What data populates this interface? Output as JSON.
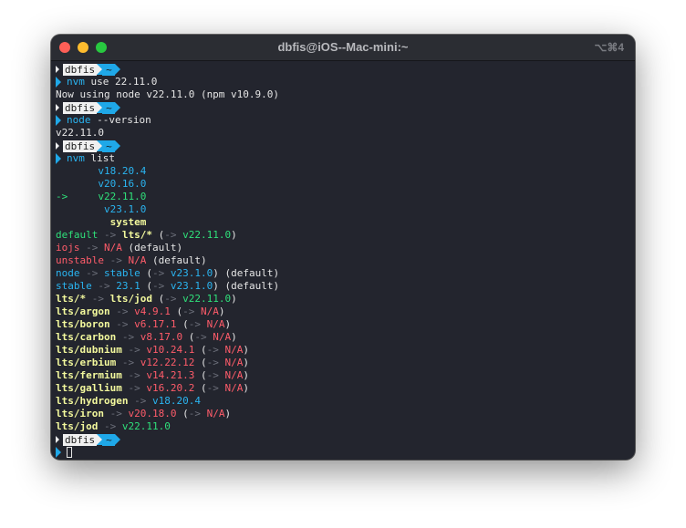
{
  "window": {
    "title": "dbfis@iOS--Mac-mini:~",
    "shortcut": "⌥⌘4"
  },
  "prompt": {
    "user": "dbfis",
    "dir": "~"
  },
  "lines": [
    {
      "kind": "prompt"
    },
    {
      "kind": "cmd",
      "segs": [
        {
          "t": "nvm",
          "c": "blue"
        },
        {
          "t": " use 22.11.0",
          "c": "white"
        }
      ]
    },
    {
      "kind": "out",
      "segs": [
        {
          "t": "Now using node v22.11.0 (npm v10.9.0)",
          "c": "white"
        }
      ]
    },
    {
      "kind": "prompt"
    },
    {
      "kind": "cmd",
      "segs": [
        {
          "t": "node",
          "c": "blue"
        },
        {
          "t": " --version",
          "c": "white"
        }
      ]
    },
    {
      "kind": "out",
      "segs": [
        {
          "t": "v22.11.0",
          "c": "white"
        }
      ]
    },
    {
      "kind": "prompt"
    },
    {
      "kind": "cmd",
      "segs": [
        {
          "t": "nvm",
          "c": "blue"
        },
        {
          "t": " list",
          "c": "white"
        }
      ]
    },
    {
      "kind": "out",
      "segs": [
        {
          "t": "       v18.20.4",
          "c": "blue"
        }
      ]
    },
    {
      "kind": "out",
      "segs": [
        {
          "t": "       v20.16.0",
          "c": "blue"
        }
      ]
    },
    {
      "kind": "out",
      "segs": [
        {
          "t": "->     v22.11.0",
          "c": "green"
        }
      ]
    },
    {
      "kind": "out",
      "segs": [
        {
          "t": "        v23.1.0",
          "c": "blue"
        }
      ]
    },
    {
      "kind": "out",
      "segs": [
        {
          "t": "         system",
          "c": "yellow"
        }
      ]
    },
    {
      "kind": "out",
      "segs": [
        {
          "t": "default",
          "c": "green"
        },
        {
          "t": " -> ",
          "c": "gray"
        },
        {
          "t": "lts/*",
          "c": "yellow"
        },
        {
          "t": " (",
          "c": "white"
        },
        {
          "t": "->",
          "c": "gray"
        },
        {
          "t": " v22.11.0",
          "c": "green"
        },
        {
          "t": ")",
          "c": "white"
        }
      ]
    },
    {
      "kind": "out",
      "segs": [
        {
          "t": "iojs",
          "c": "red"
        },
        {
          "t": " -> ",
          "c": "gray"
        },
        {
          "t": "N/A",
          "c": "red"
        },
        {
          "t": " (default)",
          "c": "white"
        }
      ]
    },
    {
      "kind": "out",
      "segs": [
        {
          "t": "unstable",
          "c": "red"
        },
        {
          "t": " -> ",
          "c": "gray"
        },
        {
          "t": "N/A",
          "c": "red"
        },
        {
          "t": " (default)",
          "c": "white"
        }
      ]
    },
    {
      "kind": "out",
      "segs": [
        {
          "t": "node",
          "c": "blue"
        },
        {
          "t": " -> ",
          "c": "gray"
        },
        {
          "t": "stable",
          "c": "blue"
        },
        {
          "t": " (",
          "c": "white"
        },
        {
          "t": "->",
          "c": "gray"
        },
        {
          "t": " v23.1.0",
          "c": "blue"
        },
        {
          "t": ") (default)",
          "c": "white"
        }
      ]
    },
    {
      "kind": "out",
      "segs": [
        {
          "t": "stable",
          "c": "blue"
        },
        {
          "t": " -> ",
          "c": "gray"
        },
        {
          "t": "23.1",
          "c": "blue"
        },
        {
          "t": " (",
          "c": "white"
        },
        {
          "t": "->",
          "c": "gray"
        },
        {
          "t": " v23.1.0",
          "c": "blue"
        },
        {
          "t": ") (default)",
          "c": "white"
        }
      ]
    },
    {
      "kind": "out",
      "segs": [
        {
          "t": "lts/*",
          "c": "yellow"
        },
        {
          "t": " -> ",
          "c": "gray"
        },
        {
          "t": "lts/jod",
          "c": "yellow"
        },
        {
          "t": " (",
          "c": "white"
        },
        {
          "t": "->",
          "c": "gray"
        },
        {
          "t": " v22.11.0",
          "c": "green"
        },
        {
          "t": ")",
          "c": "white"
        }
      ]
    },
    {
      "kind": "out",
      "segs": [
        {
          "t": "lts/argon",
          "c": "yellow"
        },
        {
          "t": " -> ",
          "c": "gray"
        },
        {
          "t": "v4.9.1",
          "c": "red"
        },
        {
          "t": " (",
          "c": "white"
        },
        {
          "t": "->",
          "c": "gray"
        },
        {
          "t": " N/A",
          "c": "red"
        },
        {
          "t": ")",
          "c": "white"
        }
      ]
    },
    {
      "kind": "out",
      "segs": [
        {
          "t": "lts/boron",
          "c": "yellow"
        },
        {
          "t": " -> ",
          "c": "gray"
        },
        {
          "t": "v6.17.1",
          "c": "red"
        },
        {
          "t": " (",
          "c": "white"
        },
        {
          "t": "->",
          "c": "gray"
        },
        {
          "t": " N/A",
          "c": "red"
        },
        {
          "t": ")",
          "c": "white"
        }
      ]
    },
    {
      "kind": "out",
      "segs": [
        {
          "t": "lts/carbon",
          "c": "yellow"
        },
        {
          "t": " -> ",
          "c": "gray"
        },
        {
          "t": "v8.17.0",
          "c": "red"
        },
        {
          "t": " (",
          "c": "white"
        },
        {
          "t": "->",
          "c": "gray"
        },
        {
          "t": " N/A",
          "c": "red"
        },
        {
          "t": ")",
          "c": "white"
        }
      ]
    },
    {
      "kind": "out",
      "segs": [
        {
          "t": "lts/dubnium",
          "c": "yellow"
        },
        {
          "t": " -> ",
          "c": "gray"
        },
        {
          "t": "v10.24.1",
          "c": "red"
        },
        {
          "t": " (",
          "c": "white"
        },
        {
          "t": "->",
          "c": "gray"
        },
        {
          "t": " N/A",
          "c": "red"
        },
        {
          "t": ")",
          "c": "white"
        }
      ]
    },
    {
      "kind": "out",
      "segs": [
        {
          "t": "lts/erbium",
          "c": "yellow"
        },
        {
          "t": " -> ",
          "c": "gray"
        },
        {
          "t": "v12.22.12",
          "c": "red"
        },
        {
          "t": " (",
          "c": "white"
        },
        {
          "t": "->",
          "c": "gray"
        },
        {
          "t": " N/A",
          "c": "red"
        },
        {
          "t": ")",
          "c": "white"
        }
      ]
    },
    {
      "kind": "out",
      "segs": [
        {
          "t": "lts/fermium",
          "c": "yellow"
        },
        {
          "t": " -> ",
          "c": "gray"
        },
        {
          "t": "v14.21.3",
          "c": "red"
        },
        {
          "t": " (",
          "c": "white"
        },
        {
          "t": "->",
          "c": "gray"
        },
        {
          "t": " N/A",
          "c": "red"
        },
        {
          "t": ")",
          "c": "white"
        }
      ]
    },
    {
      "kind": "out",
      "segs": [
        {
          "t": "lts/gallium",
          "c": "yellow"
        },
        {
          "t": " -> ",
          "c": "gray"
        },
        {
          "t": "v16.20.2",
          "c": "red"
        },
        {
          "t": " (",
          "c": "white"
        },
        {
          "t": "->",
          "c": "gray"
        },
        {
          "t": " N/A",
          "c": "red"
        },
        {
          "t": ")",
          "c": "white"
        }
      ]
    },
    {
      "kind": "out",
      "segs": [
        {
          "t": "lts/hydrogen",
          "c": "yellow"
        },
        {
          "t": " -> ",
          "c": "gray"
        },
        {
          "t": "v18.20.4",
          "c": "blue"
        }
      ]
    },
    {
      "kind": "out",
      "segs": [
        {
          "t": "lts/iron",
          "c": "yellow"
        },
        {
          "t": " -> ",
          "c": "gray"
        },
        {
          "t": "v20.18.0",
          "c": "red"
        },
        {
          "t": " (",
          "c": "white"
        },
        {
          "t": "->",
          "c": "gray"
        },
        {
          "t": " N/A",
          "c": "red"
        },
        {
          "t": ")",
          "c": "white"
        }
      ]
    },
    {
      "kind": "out",
      "segs": [
        {
          "t": "lts/jod",
          "c": "yellow"
        },
        {
          "t": " -> ",
          "c": "gray"
        },
        {
          "t": "v22.11.0",
          "c": "green"
        }
      ]
    },
    {
      "kind": "prompt"
    },
    {
      "kind": "input"
    }
  ]
}
